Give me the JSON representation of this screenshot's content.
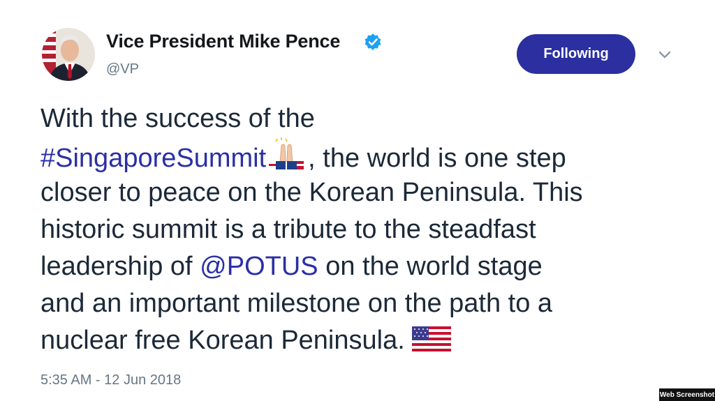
{
  "author": {
    "display_name": "Vice President Mike Pence",
    "handle": "@VP",
    "verified_icon": "verified-badge-icon",
    "avatar": "avatar-photo"
  },
  "follow_button": {
    "label": "Following"
  },
  "more_menu": {
    "icon": "chevron-down-icon"
  },
  "tweet": {
    "line1": "With the success of the",
    "hashtag": "#SingaporeSummit",
    "line2_rest": ", the world is one step",
    "line3": "closer to peace on the Korean Peninsula. This",
    "line4": "historic summit is a tribute to the steadfast",
    "line5_pre": "leadership of ",
    "mention": "@POTUS",
    "line5_post": " on the world stage",
    "line6": "and an important milestone on the path to a",
    "line7": "nuclear free Korean Peninsula. ",
    "emoji_praying": "praying-hands-emoji",
    "emoji_flag": "us-flag-emoji"
  },
  "timestamp": "5:35 AM - 12 Jun 2018",
  "watermark": "Web Screenshot",
  "colors": {
    "link": "#2b2fa6",
    "button": "#2c2f9f",
    "text": "#1c2938",
    "muted": "#657786",
    "verified": "#1da1f2"
  }
}
